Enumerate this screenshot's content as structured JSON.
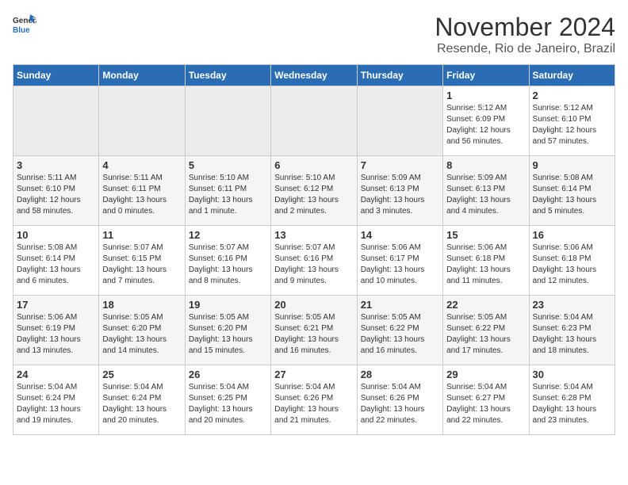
{
  "logo": {
    "line1": "General",
    "line2": "Blue"
  },
  "title": "November 2024",
  "subtitle": "Resende, Rio de Janeiro, Brazil",
  "weekdays": [
    "Sunday",
    "Monday",
    "Tuesday",
    "Wednesday",
    "Thursday",
    "Friday",
    "Saturday"
  ],
  "weeks": [
    [
      {
        "day": "",
        "info": ""
      },
      {
        "day": "",
        "info": ""
      },
      {
        "day": "",
        "info": ""
      },
      {
        "day": "",
        "info": ""
      },
      {
        "day": "",
        "info": ""
      },
      {
        "day": "1",
        "info": "Sunrise: 5:12 AM\nSunset: 6:09 PM\nDaylight: 12 hours\nand 56 minutes."
      },
      {
        "day": "2",
        "info": "Sunrise: 5:12 AM\nSunset: 6:10 PM\nDaylight: 12 hours\nand 57 minutes."
      }
    ],
    [
      {
        "day": "3",
        "info": "Sunrise: 5:11 AM\nSunset: 6:10 PM\nDaylight: 12 hours\nand 58 minutes."
      },
      {
        "day": "4",
        "info": "Sunrise: 5:11 AM\nSunset: 6:11 PM\nDaylight: 13 hours\nand 0 minutes."
      },
      {
        "day": "5",
        "info": "Sunrise: 5:10 AM\nSunset: 6:11 PM\nDaylight: 13 hours\nand 1 minute."
      },
      {
        "day": "6",
        "info": "Sunrise: 5:10 AM\nSunset: 6:12 PM\nDaylight: 13 hours\nand 2 minutes."
      },
      {
        "day": "7",
        "info": "Sunrise: 5:09 AM\nSunset: 6:13 PM\nDaylight: 13 hours\nand 3 minutes."
      },
      {
        "day": "8",
        "info": "Sunrise: 5:09 AM\nSunset: 6:13 PM\nDaylight: 13 hours\nand 4 minutes."
      },
      {
        "day": "9",
        "info": "Sunrise: 5:08 AM\nSunset: 6:14 PM\nDaylight: 13 hours\nand 5 minutes."
      }
    ],
    [
      {
        "day": "10",
        "info": "Sunrise: 5:08 AM\nSunset: 6:14 PM\nDaylight: 13 hours\nand 6 minutes."
      },
      {
        "day": "11",
        "info": "Sunrise: 5:07 AM\nSunset: 6:15 PM\nDaylight: 13 hours\nand 7 minutes."
      },
      {
        "day": "12",
        "info": "Sunrise: 5:07 AM\nSunset: 6:16 PM\nDaylight: 13 hours\nand 8 minutes."
      },
      {
        "day": "13",
        "info": "Sunrise: 5:07 AM\nSunset: 6:16 PM\nDaylight: 13 hours\nand 9 minutes."
      },
      {
        "day": "14",
        "info": "Sunrise: 5:06 AM\nSunset: 6:17 PM\nDaylight: 13 hours\nand 10 minutes."
      },
      {
        "day": "15",
        "info": "Sunrise: 5:06 AM\nSunset: 6:18 PM\nDaylight: 13 hours\nand 11 minutes."
      },
      {
        "day": "16",
        "info": "Sunrise: 5:06 AM\nSunset: 6:18 PM\nDaylight: 13 hours\nand 12 minutes."
      }
    ],
    [
      {
        "day": "17",
        "info": "Sunrise: 5:06 AM\nSunset: 6:19 PM\nDaylight: 13 hours\nand 13 minutes."
      },
      {
        "day": "18",
        "info": "Sunrise: 5:05 AM\nSunset: 6:20 PM\nDaylight: 13 hours\nand 14 minutes."
      },
      {
        "day": "19",
        "info": "Sunrise: 5:05 AM\nSunset: 6:20 PM\nDaylight: 13 hours\nand 15 minutes."
      },
      {
        "day": "20",
        "info": "Sunrise: 5:05 AM\nSunset: 6:21 PM\nDaylight: 13 hours\nand 16 minutes."
      },
      {
        "day": "21",
        "info": "Sunrise: 5:05 AM\nSunset: 6:22 PM\nDaylight: 13 hours\nand 16 minutes."
      },
      {
        "day": "22",
        "info": "Sunrise: 5:05 AM\nSunset: 6:22 PM\nDaylight: 13 hours\nand 17 minutes."
      },
      {
        "day": "23",
        "info": "Sunrise: 5:04 AM\nSunset: 6:23 PM\nDaylight: 13 hours\nand 18 minutes."
      }
    ],
    [
      {
        "day": "24",
        "info": "Sunrise: 5:04 AM\nSunset: 6:24 PM\nDaylight: 13 hours\nand 19 minutes."
      },
      {
        "day": "25",
        "info": "Sunrise: 5:04 AM\nSunset: 6:24 PM\nDaylight: 13 hours\nand 20 minutes."
      },
      {
        "day": "26",
        "info": "Sunrise: 5:04 AM\nSunset: 6:25 PM\nDaylight: 13 hours\nand 20 minutes."
      },
      {
        "day": "27",
        "info": "Sunrise: 5:04 AM\nSunset: 6:26 PM\nDaylight: 13 hours\nand 21 minutes."
      },
      {
        "day": "28",
        "info": "Sunrise: 5:04 AM\nSunset: 6:26 PM\nDaylight: 13 hours\nand 22 minutes."
      },
      {
        "day": "29",
        "info": "Sunrise: 5:04 AM\nSunset: 6:27 PM\nDaylight: 13 hours\nand 22 minutes."
      },
      {
        "day": "30",
        "info": "Sunrise: 5:04 AM\nSunset: 6:28 PM\nDaylight: 13 hours\nand 23 minutes."
      }
    ]
  ]
}
